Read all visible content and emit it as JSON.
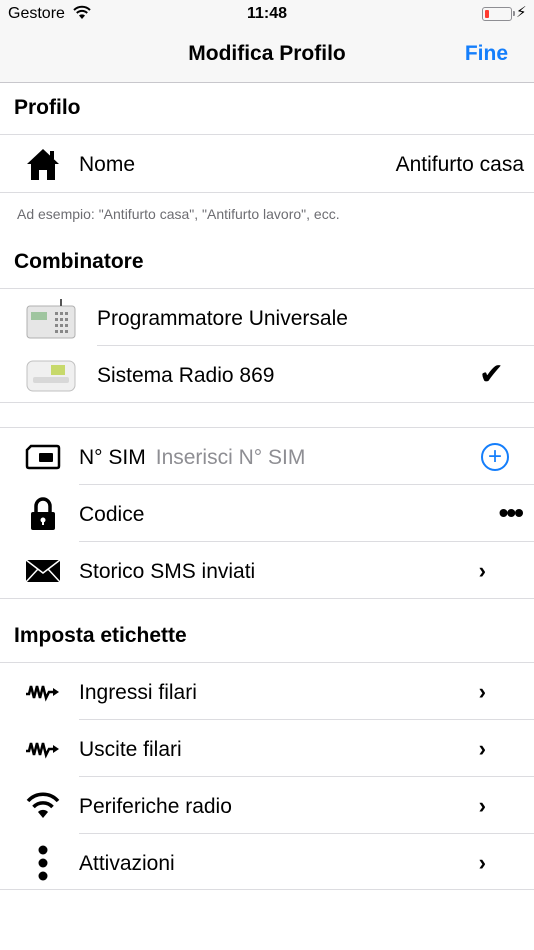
{
  "status": {
    "carrier": "Gestore",
    "time": "11:48"
  },
  "nav": {
    "title": "Modifica Profilo",
    "done": "Fine"
  },
  "profilo": {
    "header": "Profilo",
    "name_label": "Nome",
    "name_value": "Antifurto casa",
    "note": "Ad esempio: \"Antifurto casa\", \"Antifurto lavoro\", ecc."
  },
  "combinatore": {
    "header": "Combinatore",
    "items": [
      {
        "label": "Programmatore Universale",
        "selected": false
      },
      {
        "label": "Sistema Radio 869",
        "selected": true
      }
    ]
  },
  "sim": {
    "sim_label": "N° SIM",
    "sim_placeholder": "Inserisci N° SIM",
    "code_label": "Codice",
    "code_value": "•••",
    "sms_label": "Storico SMS inviati"
  },
  "etichette": {
    "header": "Imposta etichette",
    "items": [
      {
        "label": "Ingressi filari",
        "icon": "wired-signal-icon"
      },
      {
        "label": "Uscite filari",
        "icon": "wired-signal-icon"
      },
      {
        "label": "Periferiche radio",
        "icon": "wifi-icon"
      },
      {
        "label": "Attivazioni",
        "icon": "vertical-dots-icon"
      }
    ]
  },
  "colors": {
    "accent": "#147efb",
    "battery_low": "#ff3b30"
  }
}
